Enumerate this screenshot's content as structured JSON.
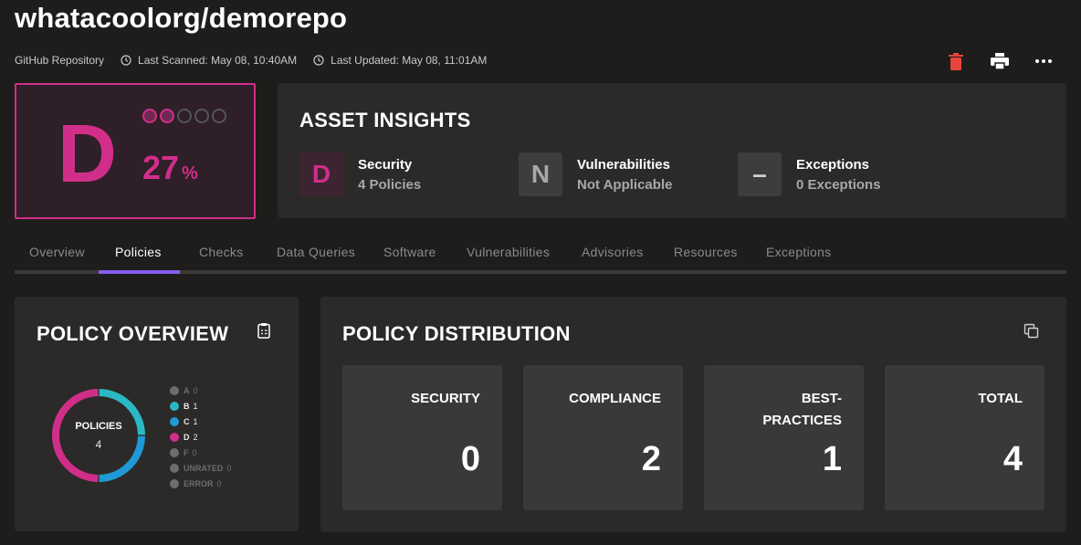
{
  "header": {
    "title": "whatacoolorg/demorepo",
    "asset_type": "GitHub Repository",
    "last_scanned": "Last Scanned: May 08, 10:40AM",
    "last_updated": "Last Updated: May 08, 11:01AM",
    "icons": [
      "clock-icon",
      "trash-icon",
      "print-icon",
      "more-icon"
    ]
  },
  "score": {
    "grade": "D",
    "percent": "27",
    "unit": "%",
    "dots_filled": 2,
    "dots_total": 5,
    "color": "#d12e8a"
  },
  "insights": {
    "title": "ASSET INSIGHTS",
    "items": [
      {
        "badge": "D",
        "label": "Security",
        "value": "4 Policies"
      },
      {
        "badge": "N",
        "label": "Vulnerabilities",
        "value": "Not Applicable"
      },
      {
        "badge": "–",
        "label": "Exceptions",
        "value": "0 Exceptions"
      }
    ]
  },
  "tabs": [
    "Overview",
    "Policies",
    "Checks",
    "Data Queries",
    "Software",
    "Vulnerabilities",
    "Advisories",
    "Resources",
    "Exceptions"
  ],
  "active_tab": "Policies",
  "policy_overview": {
    "title": "POLICY OVERVIEW",
    "center_label": "POLICIES",
    "center_count": "4",
    "legend": [
      {
        "grade": "A",
        "count": "0",
        "color": "#6d6d6d"
      },
      {
        "grade": "B",
        "count": "1",
        "color": "#2ab8c4"
      },
      {
        "grade": "C",
        "count": "1",
        "color": "#1f9ad6"
      },
      {
        "grade": "D",
        "count": "2",
        "color": "#d12e8a"
      },
      {
        "grade": "F",
        "count": "0",
        "color": "#6d6d6d"
      },
      {
        "grade": "UNRATED",
        "count": "0",
        "color": "#6d6d6d"
      },
      {
        "grade": "ERROR",
        "count": "0",
        "color": "#6d6d6d"
      }
    ]
  },
  "policy_distribution": {
    "title": "POLICY DISTRIBUTION",
    "cards": [
      {
        "label1": "SECURITY",
        "label2": "",
        "value": "0"
      },
      {
        "label1": "COMPLIANCE",
        "label2": "",
        "value": "2"
      },
      {
        "label1": "BEST-",
        "label2": "PRACTICES",
        "value": "1"
      },
      {
        "label1": "TOTAL",
        "label2": "",
        "value": "4"
      }
    ]
  }
}
